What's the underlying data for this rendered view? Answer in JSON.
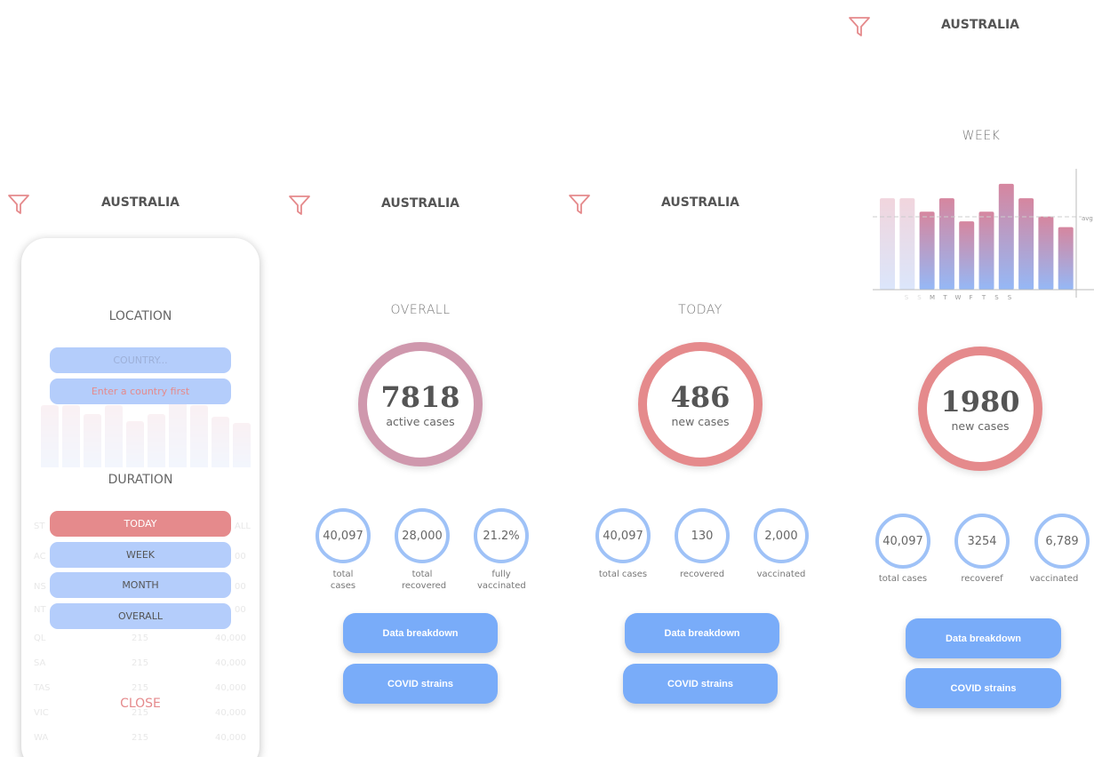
{
  "country": "AUSTRALIA",
  "modal": {
    "location_title": "LOCATION",
    "country_placeholder": "COUNTRY...",
    "error_text": "Enter a country first",
    "duration_title": "DURATION",
    "options": [
      "TODAY",
      "WEEK",
      "MONTH",
      "OVERALL"
    ],
    "selected_option": "TODAY",
    "close_label": "CLOSE",
    "background_table": {
      "rows": [
        [
          "ST",
          "",
          "ALL"
        ],
        [
          "AC",
          "",
          "00"
        ],
        [
          "NS",
          "",
          "00"
        ],
        [
          "NT",
          "",
          "00"
        ],
        [
          "QL",
          "215",
          "40,000"
        ],
        [
          "SA",
          "215",
          "40,000"
        ],
        [
          "TAS",
          "215",
          "40,000"
        ],
        [
          "VIC",
          "215",
          "40,000"
        ],
        [
          "WA",
          "215",
          "40,000"
        ]
      ]
    }
  },
  "overall": {
    "title": "OVERALL",
    "main_value": "7818",
    "main_label": "active cases",
    "stats": [
      {
        "value": "40,097",
        "label": "total cases"
      },
      {
        "value": "28,000",
        "label": "total recovered"
      },
      {
        "value": "21.2%",
        "label": "fully vaccinated"
      }
    ]
  },
  "today": {
    "title": "TODAY",
    "main_value": "486",
    "main_label": "new cases",
    "stats": [
      {
        "value": "40,097",
        "label": "total cases"
      },
      {
        "value": "130",
        "label": "recovered"
      },
      {
        "value": "2,000",
        "label": "vaccinated"
      }
    ]
  },
  "week": {
    "title": "WEEK",
    "main_value": "1980",
    "main_label": "new cases",
    "stats": [
      {
        "value": "40,097",
        "label": "total cases"
      },
      {
        "value": "3254",
        "label": "recoveref"
      },
      {
        "value": "6,789",
        "label": "vaccinated"
      }
    ],
    "avg_label": "avg"
  },
  "buttons": {
    "breakdown": "Data breakdown",
    "strains": "COVID strains"
  },
  "chart_data": {
    "type": "bar",
    "categories": [
      "S",
      "S",
      "M",
      "T",
      "W",
      "F",
      "T",
      "S",
      "S"
    ],
    "values": [
      95,
      95,
      81,
      95,
      71,
      81,
      110,
      95,
      76,
      65
    ],
    "bar_count": 10,
    "avg_line": true,
    "avg_label": "avg",
    "ylim": [
      0,
      120
    ]
  },
  "colors": {
    "accent_red": "#e58a8c",
    "accent_blue": "#79acf9",
    "ring_blue": "#9fc2f7",
    "pill_blue": "#b4cdfb"
  }
}
